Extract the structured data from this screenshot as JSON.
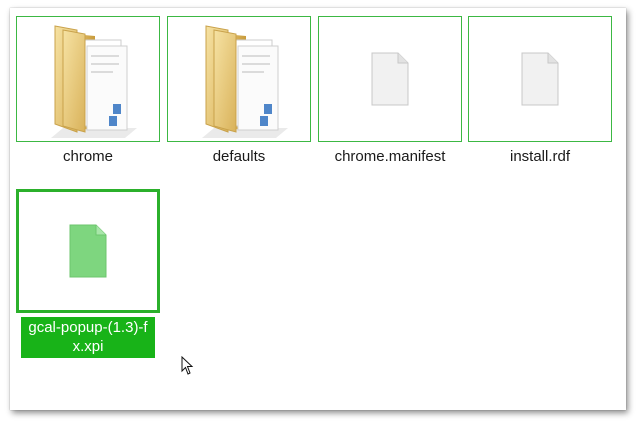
{
  "files": [
    {
      "name": "chrome",
      "icon": "folder-icon",
      "selected": false
    },
    {
      "name": "defaults",
      "icon": "folder-icon",
      "selected": false
    },
    {
      "name": "chrome.manifest",
      "icon": "file-icon",
      "selected": false
    },
    {
      "name": "install.rdf",
      "icon": "file-icon",
      "selected": false
    },
    {
      "name": "gcal-popup-(1.3)-fx.xpi",
      "icon": "xpi-file-icon",
      "selected": true
    }
  ],
  "colors": {
    "selection_fill": "#18b318",
    "thumbnail_border": "#3cb843",
    "xpi_icon": "#7ed67f"
  }
}
